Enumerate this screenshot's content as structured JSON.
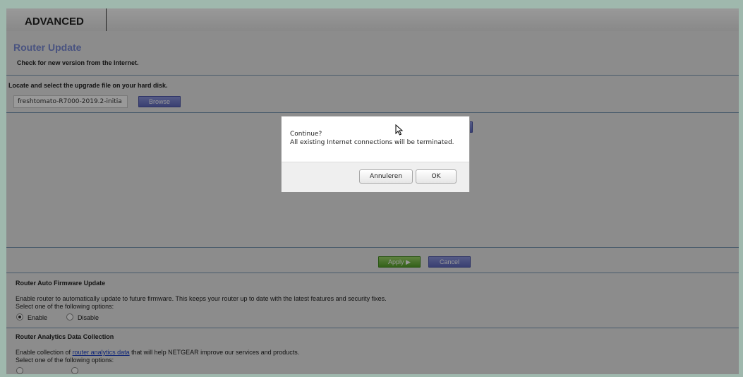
{
  "tabs": {
    "advanced": "ADVANCED"
  },
  "page_title": "Router Update",
  "check_section": {
    "label": "Check for new version from the Internet."
  },
  "upgrade": {
    "label": "Locate and select the upgrade file on your hard disk.",
    "file_value": "freshtomato-R7000-2019.2-initia",
    "browse_label": "Browse"
  },
  "actions": {
    "apply_label": "Apply ▶",
    "cancel_label": "Cancel"
  },
  "auto_update": {
    "title": "Router Auto Firmware Update",
    "description": "Enable router to automatically update to future firmware. This keeps your router up to date with the latest features and security fixes.",
    "select_label": "Select one of the following options:",
    "enable_label": "Enable",
    "disable_label": "Disable",
    "selected": "Enable"
  },
  "analytics": {
    "title": "Router Analytics Data Collection",
    "desc_prefix": "Enable collection of ",
    "link_text": "router analytics data",
    "desc_suffix": " that will help NETGEAR improve our services and products.",
    "select_label": "Select one of the following options:"
  },
  "dialog": {
    "title": "Continue?",
    "message": "All existing Internet connections will be terminated.",
    "cancel_label": "Annuleren",
    "ok_label": "OK"
  },
  "colors": {
    "background": "#9fb8ad",
    "page_title": "#7a8ad6",
    "apply": "#55a22a",
    "cancel": "#5f69bf",
    "link": "#1a3fc7"
  }
}
